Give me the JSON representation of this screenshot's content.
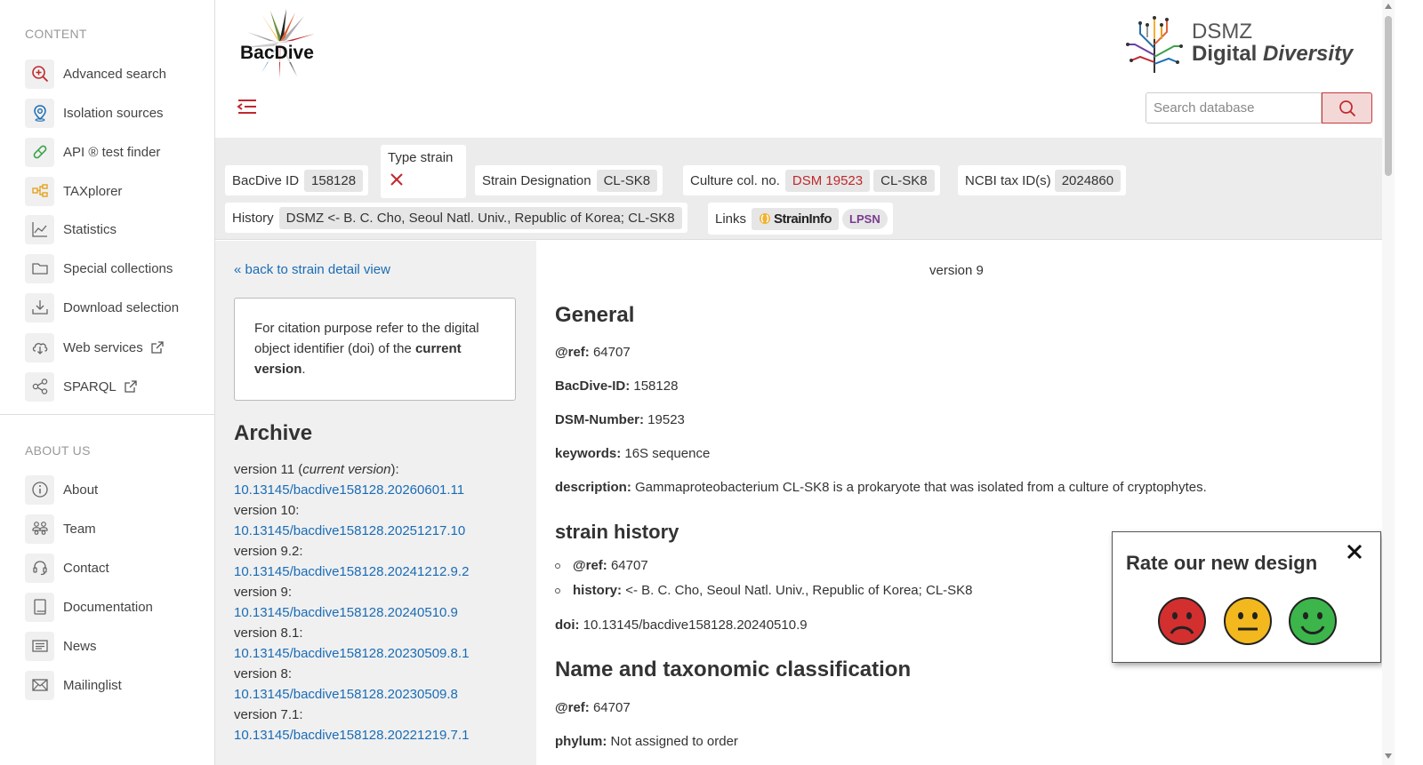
{
  "sidebar": {
    "content_title": "CONTENT",
    "about_title": "ABOUT US",
    "content_items": [
      {
        "label": "Advanced search",
        "icon": "zoom-plus-icon"
      },
      {
        "label": "Isolation sources",
        "icon": "map-pin-icon"
      },
      {
        "label": "API ® test finder",
        "icon": "pill-icon"
      },
      {
        "label": "TAXplorer",
        "icon": "hierarchy-icon"
      },
      {
        "label": "Statistics",
        "icon": "line-chart-icon"
      },
      {
        "label": "Special collections",
        "icon": "folder-icon"
      },
      {
        "label": "Download selection",
        "icon": "download-icon"
      },
      {
        "label": "Web services",
        "icon": "cloud-download-icon"
      },
      {
        "label": "SPARQL",
        "icon": "share-nodes-icon"
      }
    ],
    "about_items": [
      {
        "label": "About",
        "icon": "info-icon"
      },
      {
        "label": "Team",
        "icon": "team-icon"
      },
      {
        "label": "Contact",
        "icon": "headset-icon"
      },
      {
        "label": "Documentation",
        "icon": "book-icon"
      },
      {
        "label": "News",
        "icon": "newspaper-icon"
      },
      {
        "label": "Mailinglist",
        "icon": "mail-icon"
      }
    ]
  },
  "header": {
    "logo_text": "BacDive",
    "dsmz_line1": "DSMZ",
    "dsmz_line2a": "Digital ",
    "dsmz_line2b": "Diversity",
    "search_placeholder": "Search database"
  },
  "band": {
    "bacdive_id_label": "BacDive ID",
    "bacdive_id_value": "158128",
    "type_strain_label": "Type strain",
    "strain_designation_label": "Strain Designation",
    "strain_designation_value": "CL-SK8",
    "culture_col_label": "Culture col. no.",
    "culture_col_value1": "DSM 19523",
    "culture_col_value2": "CL-SK8",
    "ncbi_label": "NCBI tax ID(s)",
    "ncbi_value": "2024860",
    "history_label": "History",
    "history_value": "DSMZ <- B. C. Cho, Seoul Natl. Univ., Republic of Korea; CL-SK8",
    "links_label": "Links",
    "straininfo_label": "StrainInfo",
    "lpsn_label": "LPSN"
  },
  "left": {
    "back_link": "« back to strain detail view",
    "cite_text1": "For citation purpose refer to the digital object identifier (doi) of the ",
    "cite_bold": "current version",
    "cite_end": ".",
    "archive_title": "Archive",
    "versions": [
      {
        "label": "version 11 (current version):",
        "doi": "10.13145/bacdive158128.20260601.11"
      },
      {
        "label": "version 10:",
        "doi": "10.13145/bacdive158128.20251217.10"
      },
      {
        "label": "version 9.2:",
        "doi": "10.13145/bacdive158128.20241212.9.2"
      },
      {
        "label": "version 9:",
        "doi": "10.13145/bacdive158128.20240510.9"
      },
      {
        "label": "version 8.1:",
        "doi": "10.13145/bacdive158128.20230509.8.1"
      },
      {
        "label": "version 8:",
        "doi": "10.13145/bacdive158128.20230509.8"
      },
      {
        "label": "version 7.1:",
        "doi": "10.13145/bacdive158128.20221219.7.1"
      }
    ]
  },
  "main": {
    "version_label": "version 9",
    "general_title": "General",
    "ref_key": "@ref:",
    "ref_value": "64707",
    "bacdive_id_key": "BacDive-ID:",
    "bacdive_id_value": "158128",
    "dsm_key": "DSM-Number:",
    "dsm_value": "19523",
    "keywords_key": "keywords:",
    "keywords_value": "16S sequence",
    "description_key": "description:",
    "description_value": "Gammaproteobacterium CL-SK8 is a prokaryote that was isolated from a culture of cryptophytes.",
    "strain_history_title": "strain history",
    "sh_ref_key": "@ref:",
    "sh_ref_value": "64707",
    "sh_history_key": "history:",
    "sh_history_value": "<- B. C. Cho, Seoul Natl. Univ., Republic of Korea; CL-SK8",
    "doi_key": "doi:",
    "doi_value": "10.13145/bacdive158128.20240510.9",
    "taxo_title": "Name and taxonomic classification",
    "taxo_ref_key": "@ref:",
    "taxo_ref_value": "64707",
    "phylum_key": "phylum:",
    "phylum_value": "Not assigned to order"
  },
  "rating": {
    "title": "Rate our new design"
  },
  "colors": {
    "accent_red": "#c0282d",
    "link_blue": "#1a6cb5"
  }
}
